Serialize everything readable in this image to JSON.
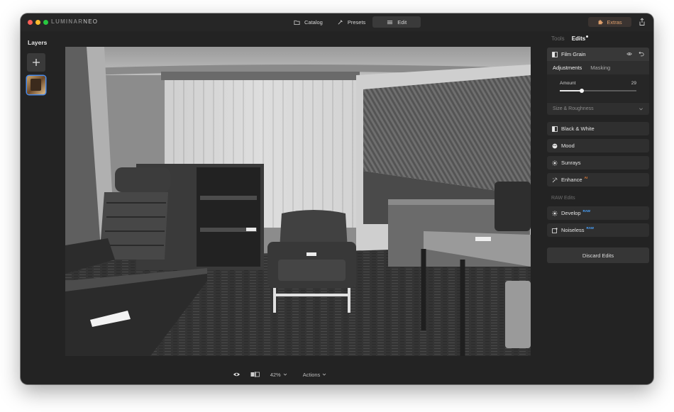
{
  "app": {
    "logo_primary": "LUMINAR",
    "logo_secondary": "NEO"
  },
  "topnav": {
    "catalog": "Catalog",
    "presets": "Presets",
    "edit": "Edit",
    "active": "Edit"
  },
  "extras": {
    "label": "Extras"
  },
  "left_panel": {
    "title": "Layers"
  },
  "right_panel": {
    "tabs": {
      "tools": "Tools",
      "edits": "Edits"
    },
    "film_grain": {
      "title": "Film Grain",
      "subtabs": {
        "adjustments": "Adjustments",
        "masking": "Masking"
      },
      "amount": {
        "label": "Amount",
        "value": "29",
        "min": 0,
        "max": 100
      },
      "size_roughness": "Size & Roughness"
    },
    "tools": [
      {
        "label": "Black & White",
        "icon": "black-white-icon"
      },
      {
        "label": "Mood",
        "icon": "mood-icon"
      },
      {
        "label": "Sunrays",
        "icon": "sunrays-icon"
      },
      {
        "label": "Enhance",
        "icon": "enhance-icon",
        "badge": "AI"
      }
    ],
    "raw_section": "RAW Edits",
    "raw_tools": [
      {
        "label": "Develop",
        "icon": "develop-icon",
        "badge": "RAW"
      },
      {
        "label": "Noiseless",
        "icon": "noiseless-icon",
        "badge": "RAW"
      }
    ],
    "discard": "Discard Edits"
  },
  "bottom_bar": {
    "zoom": "42%",
    "actions": "Actions"
  },
  "colors": {
    "accent_orange": "#e0a06c",
    "selection_blue": "#4a8bea",
    "raw_badge_blue": "#4aa3ff"
  }
}
